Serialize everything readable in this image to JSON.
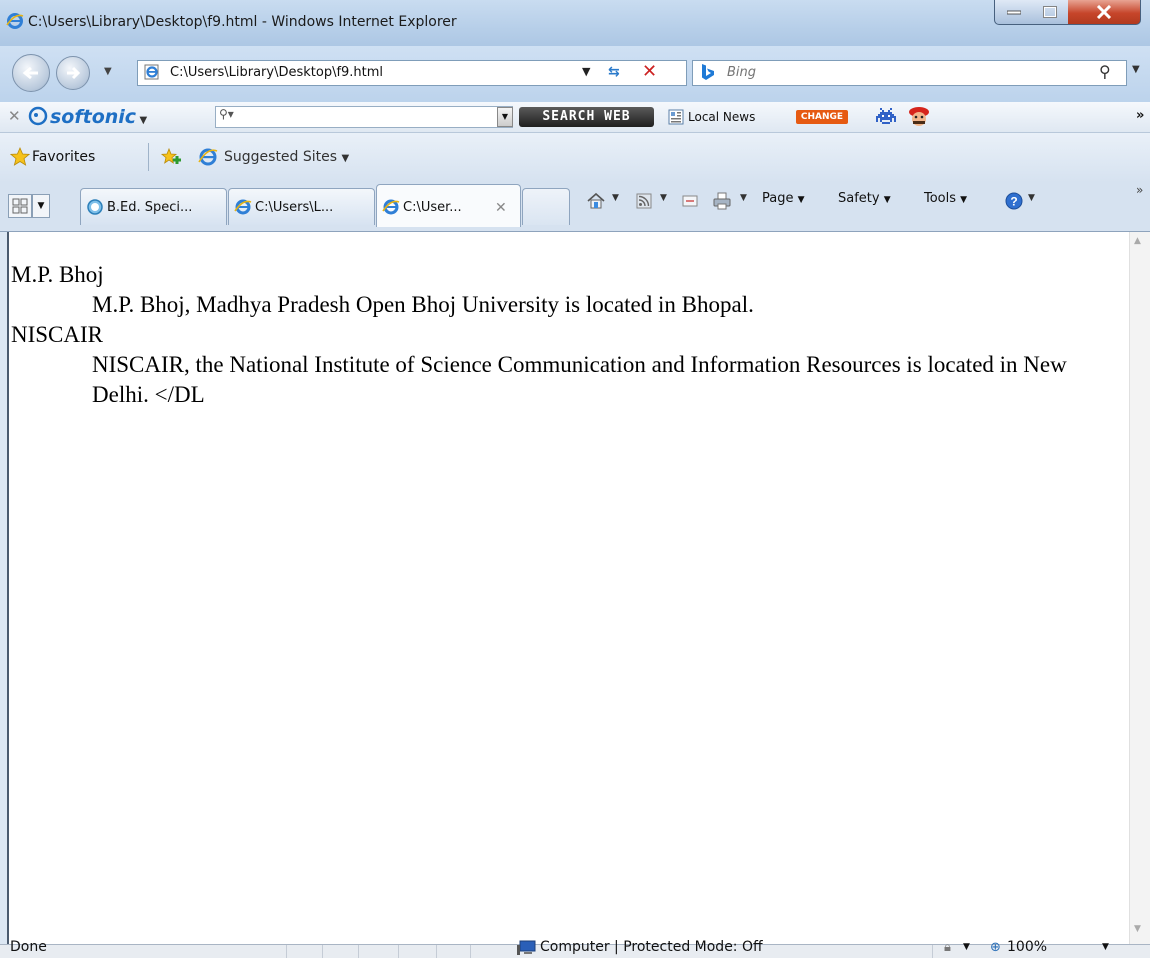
{
  "window": {
    "title": "C:\\Users\\Library\\Desktop\\f9.html - Windows Internet Explorer"
  },
  "navigation": {
    "address": "C:\\Users\\Library\\Desktop\\f9.html",
    "search_placeholder": "Bing"
  },
  "softonic_toolbar": {
    "logo": "softonic",
    "search_web_label": "SEARCH WEB",
    "local_news_label": "Local News",
    "change_badge": "CHANGE",
    "more": "»"
  },
  "favorites_bar": {
    "favorites_label": "Favorites",
    "suggested_sites_label": "Suggested Sites"
  },
  "tabs": [
    {
      "label": "B.Ed. Speci...",
      "icon": "loading-icon"
    },
    {
      "label": "C:\\Users\\L...",
      "icon": "ie-icon"
    },
    {
      "label": "C:\\User...",
      "icon": "ie-icon",
      "active": true
    }
  ],
  "command_bar": {
    "page_label": "Page",
    "safety_label": "Safety",
    "tools_label": "Tools",
    "more": "»"
  },
  "content": {
    "entries": [
      {
        "term": "M.P. Bhoj",
        "definition": "M.P. Bhoj, Madhya Pradesh Open Bhoj University is located in Bhopal."
      },
      {
        "term": "NISCAIR",
        "definition": "NISCAIR, the National Institute of Science Communication and Information Resources is located in New Delhi. </DL"
      }
    ]
  },
  "status_bar": {
    "status": "Done",
    "zone": "Computer | Protected Mode: Off",
    "zoom": "100%"
  }
}
